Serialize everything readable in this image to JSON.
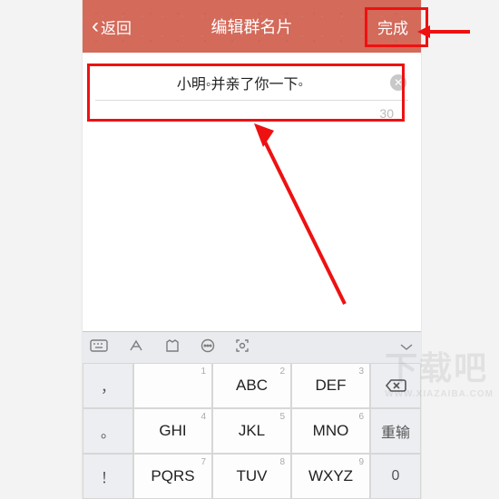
{
  "header": {
    "back": "返回",
    "title": "编辑群名片",
    "done": "完成"
  },
  "input": {
    "value": "小明◦并亲了你一下◦",
    "maxlen": "30"
  },
  "keyboard": {
    "leftCol": [
      "，",
      "。",
      "！"
    ],
    "rightCol": {
      "reenter": "重输",
      "zero": "0"
    },
    "keys": [
      {
        "n": "1",
        "l": ""
      },
      {
        "n": "2",
        "l": "ABC"
      },
      {
        "n": "3",
        "l": "DEF"
      },
      {
        "n": "4",
        "l": "GHI"
      },
      {
        "n": "5",
        "l": "JKL"
      },
      {
        "n": "6",
        "l": "MNO"
      },
      {
        "n": "7",
        "l": "PQRS"
      },
      {
        "n": "8",
        "l": "TUV"
      },
      {
        "n": "9",
        "l": "WXYZ"
      }
    ]
  },
  "watermark": {
    "big": "下载吧",
    "small": "WWW.XIAZAIBA.COM"
  }
}
